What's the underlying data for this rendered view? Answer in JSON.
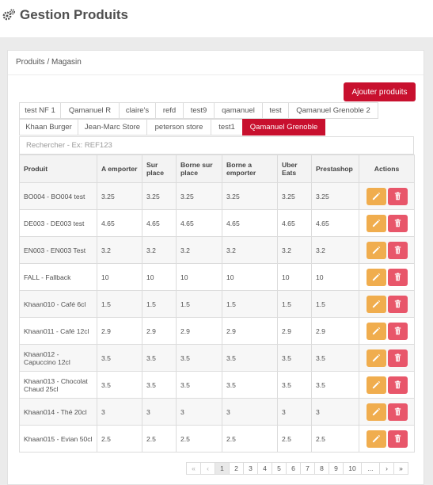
{
  "header": {
    "title": "Gestion Produits",
    "icon": "gears-icon"
  },
  "panel": {
    "title": "Produits / Magasin"
  },
  "add_button": "Ajouter produits",
  "tabs_row1": [
    "test NF 1",
    "Qamanuel R",
    "claire's",
    "refd",
    "test9",
    "qamanuel",
    "test",
    "Qamanuel Grenoble 2"
  ],
  "tabs_row2": [
    "Khaan Burger",
    "Jean-Marc Store",
    "peterson store",
    "test1",
    "Qamanuel Grenoble"
  ],
  "active_tab": "Qamanuel Grenoble",
  "search": {
    "placeholder": "Rechercher - Ex: REF123"
  },
  "table": {
    "headers": [
      "Produit",
      "A emporter",
      "Sur place",
      "Borne sur place",
      "Borne a emporter",
      "Uber Eats",
      "Prestashop",
      "Actions"
    ],
    "rows": [
      [
        "BO004 - BO004 test",
        "3.25",
        "3.25",
        "3.25",
        "3.25",
        "3.25",
        "3.25"
      ],
      [
        "DE003 - DE003 test",
        "4.65",
        "4.65",
        "4.65",
        "4.65",
        "4.65",
        "4.65"
      ],
      [
        "EN003 - EN003 Test",
        "3.2",
        "3.2",
        "3.2",
        "3.2",
        "3.2",
        "3.2"
      ],
      [
        "FALL - Fallback",
        "10",
        "10",
        "10",
        "10",
        "10",
        "10"
      ],
      [
        "Khaan010 - Café 6cl",
        "1.5",
        "1.5",
        "1.5",
        "1.5",
        "1.5",
        "1.5"
      ],
      [
        "Khaan011 - Café 12cl",
        "2.9",
        "2.9",
        "2.9",
        "2.9",
        "2.9",
        "2.9"
      ],
      [
        "Khaan012 - Capuccino 12cl",
        "3.5",
        "3.5",
        "3.5",
        "3.5",
        "3.5",
        "3.5"
      ],
      [
        "Khaan013 - Chocolat Chaud 25cl",
        "3.5",
        "3.5",
        "3.5",
        "3.5",
        "3.5",
        "3.5"
      ],
      [
        "Khaan014 - Thé 20cl",
        "3",
        "3",
        "3",
        "3",
        "3",
        "3"
      ],
      [
        "Khaan015 - Evian 50cl",
        "2.5",
        "2.5",
        "2.5",
        "2.5",
        "2.5",
        "2.5"
      ]
    ],
    "actions": {
      "edit_icon": "pencil-icon",
      "delete_icon": "trash-icon"
    }
  },
  "pagination": {
    "items": [
      "«",
      "‹",
      "1",
      "2",
      "3",
      "4",
      "5",
      "6",
      "7",
      "8",
      "9",
      "10",
      "...",
      "›",
      "»"
    ],
    "current": "1"
  },
  "colors": {
    "accent": "#c8102e",
    "edit": "#f0ad4e",
    "delete": "#e8566a"
  }
}
